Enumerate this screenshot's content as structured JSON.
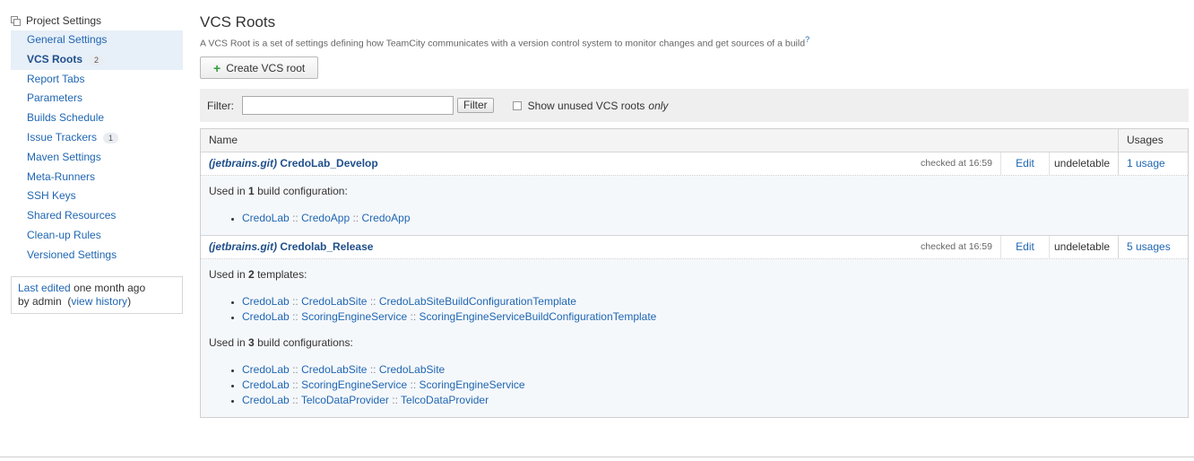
{
  "sidebar": {
    "title": "Project Settings",
    "items": [
      {
        "label": "General Settings",
        "badge": null
      },
      {
        "label": "VCS Roots",
        "badge": "2"
      },
      {
        "label": "Report Tabs",
        "badge": null
      },
      {
        "label": "Parameters",
        "badge": null
      },
      {
        "label": "Builds Schedule",
        "badge": null
      },
      {
        "label": "Issue Trackers",
        "badge": "1"
      },
      {
        "label": "Maven Settings",
        "badge": null
      },
      {
        "label": "Meta-Runners",
        "badge": null
      },
      {
        "label": "SSH Keys",
        "badge": null
      },
      {
        "label": "Shared Resources",
        "badge": null
      },
      {
        "label": "Clean-up Rules",
        "badge": null
      },
      {
        "label": "Versioned Settings",
        "badge": null
      }
    ],
    "last_edited": {
      "link": "Last edited",
      "time": "one month ago",
      "by": "by admin",
      "open_paren": "(",
      "history_link": "view history",
      "close_paren": ")"
    }
  },
  "main": {
    "title": "VCS Roots",
    "description": "A VCS Root is a set of settings defining how TeamCity communicates with a version control system to monitor changes and get sources of a build",
    "help_glyph": "?",
    "create_button": {
      "plus": "+",
      "label": "Create VCS root"
    },
    "filter": {
      "label": "Filter:",
      "input_value": "",
      "button": "Filter",
      "checkbox_label": "Show unused VCS roots",
      "checkbox_label_emph": "only"
    },
    "table": {
      "col_name": "Name",
      "col_usages": "Usages",
      "roots": [
        {
          "vcs": "(jetbrains.git)",
          "name": "CredoLab_Develop",
          "checked": "checked at 16:59",
          "edit": "Edit",
          "deletable": "undeletable",
          "usages": "1 usage",
          "groups": [
            {
              "prefix": "Used in",
              "count": "1",
              "suffix": "build configuration:",
              "items": [
                [
                  "CredoLab",
                  "CredoApp",
                  "CredoApp"
                ]
              ]
            }
          ]
        },
        {
          "vcs": "(jetbrains.git)",
          "name": "Credolab_Release",
          "checked": "checked at 16:59",
          "edit": "Edit",
          "deletable": "undeletable",
          "usages": "5 usages",
          "groups": [
            {
              "prefix": "Used in",
              "count": "2",
              "suffix": "templates:",
              "items": [
                [
                  "CredoLab",
                  "CredoLabSite",
                  "CredoLabSiteBuildConfigurationTemplate"
                ],
                [
                  "CredoLab",
                  "ScoringEngineService",
                  "ScoringEngineServiceBuildConfigurationTemplate"
                ]
              ]
            },
            {
              "prefix": "Used in",
              "count": "3",
              "suffix": "build configurations:",
              "items": [
                [
                  "CredoLab",
                  "CredoLabSite",
                  "CredoLabSite"
                ],
                [
                  "CredoLab",
                  "ScoringEngineService",
                  "ScoringEngineService"
                ],
                [
                  "CredoLab",
                  "TelcoDataProvider",
                  "TelcoDataProvider"
                ]
              ]
            }
          ]
        }
      ],
      "path_separator": "::"
    }
  }
}
